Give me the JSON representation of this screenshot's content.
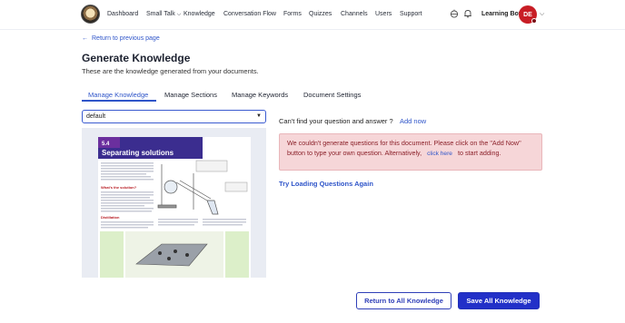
{
  "nav": {
    "items": [
      {
        "label": "Dashboard"
      },
      {
        "label": "Small Talk"
      },
      {
        "label": "Knowledge"
      },
      {
        "label": "Conversation Flow"
      },
      {
        "label": "Forms"
      },
      {
        "label": "Quizzes"
      },
      {
        "label": "Channels"
      },
      {
        "label": "Users"
      },
      {
        "label": "Support"
      }
    ],
    "user_name": "Learning Bot",
    "avatar_initials": "DE"
  },
  "page": {
    "back_link": "Return to previous page",
    "title": "Generate Knowledge",
    "subtitle": "These are the knowledge generated from your documents."
  },
  "tabs": [
    {
      "label": "Manage Knowledge",
      "active": true
    },
    {
      "label": "Manage Sections",
      "active": false
    },
    {
      "label": "Manage Keywords",
      "active": false
    },
    {
      "label": "Document Settings",
      "active": false
    }
  ],
  "document_select": {
    "value": "default"
  },
  "document_preview": {
    "section_number": "5.4",
    "heading": "Separating solutions",
    "subheading_1": "What's the solution?",
    "subheading_2": "Distillation"
  },
  "qa": {
    "prompt": "Can't find your question and answer ?",
    "add_now": "Add now",
    "alert_text_1": "We couldn't generate questions for this document. Please click on the \"Add Now\" button to type your own question. Alternatively,",
    "alert_link": "click here",
    "alert_text_2": "to start adding.",
    "try_loading": "Try Loading Questions Again"
  },
  "footer": {
    "return_button": "Return to All Knowledge",
    "save_button": "Save All Knowledge"
  },
  "colors": {
    "primary": "#2f55c9",
    "alert_bg": "#f6d6d8",
    "alert_text": "#8b2029",
    "avatar": "#c81d25"
  }
}
